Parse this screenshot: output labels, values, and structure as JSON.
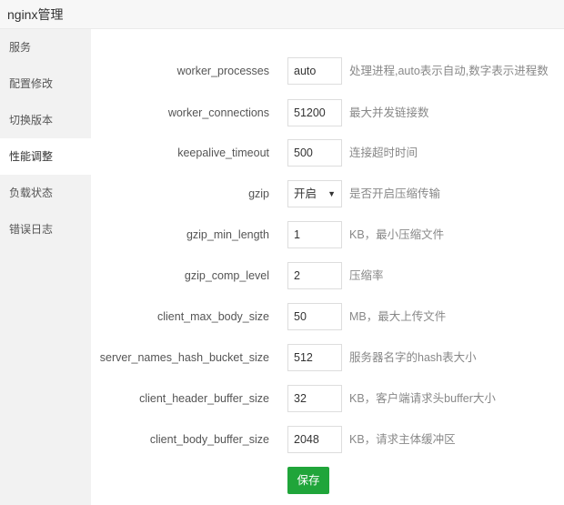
{
  "window": {
    "title": "nginx管理"
  },
  "sidebar": {
    "items": [
      {
        "label": "服务"
      },
      {
        "label": "配置修改"
      },
      {
        "label": "切换版本"
      },
      {
        "label": "性能调整",
        "active": true
      },
      {
        "label": "负载状态"
      },
      {
        "label": "错误日志"
      }
    ]
  },
  "form": {
    "rows": [
      {
        "label": "worker_processes",
        "value": "auto",
        "hint": "处理进程,auto表示自动,数字表示进程数"
      },
      {
        "label": "worker_connections",
        "value": "51200",
        "hint": "最大并发链接数"
      },
      {
        "label": "keepalive_timeout",
        "value": "500",
        "hint": "连接超时时间"
      },
      {
        "label": "gzip",
        "value": "开启",
        "hint": "是否开启压缩传输",
        "type": "select"
      },
      {
        "label": "gzip_min_length",
        "value": "1",
        "hint": "KB，最小压缩文件"
      },
      {
        "label": "gzip_comp_level",
        "value": "2",
        "hint": "压缩率"
      },
      {
        "label": "client_max_body_size",
        "value": "50",
        "hint": "MB，最大上传文件"
      },
      {
        "label": "server_names_hash_bucket_size",
        "value": "512",
        "hint": "服务器名字的hash表大小"
      },
      {
        "label": "client_header_buffer_size",
        "value": "32",
        "hint": "KB，客户端请求头buffer大小"
      },
      {
        "label": "client_body_buffer_size",
        "value": "2048",
        "hint": "KB，请求主体缓冲区"
      }
    ],
    "save_label": "保存"
  },
  "colors": {
    "accent": "#20a53a",
    "sidebar_bg": "#f2f2f2"
  }
}
